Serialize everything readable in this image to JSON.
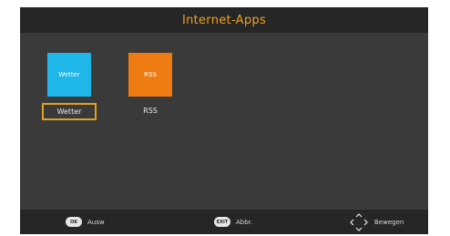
{
  "header": {
    "title": "Internet-Apps"
  },
  "apps": [
    {
      "tile_text": "Wetter",
      "label": "Wetter",
      "color": "#1fb6ea",
      "selected": true
    },
    {
      "tile_text": "RSS",
      "label": "RSS",
      "color": "#ef7c12",
      "selected": false
    }
  ],
  "footer": {
    "ok": {
      "key": "OK",
      "label": "Ausw"
    },
    "exit": {
      "key": "EXIT",
      "label": "Abbr."
    },
    "move": {
      "label": "Bewegen"
    }
  },
  "colors": {
    "accent": "#e0a11c",
    "title": "#f0a020"
  }
}
